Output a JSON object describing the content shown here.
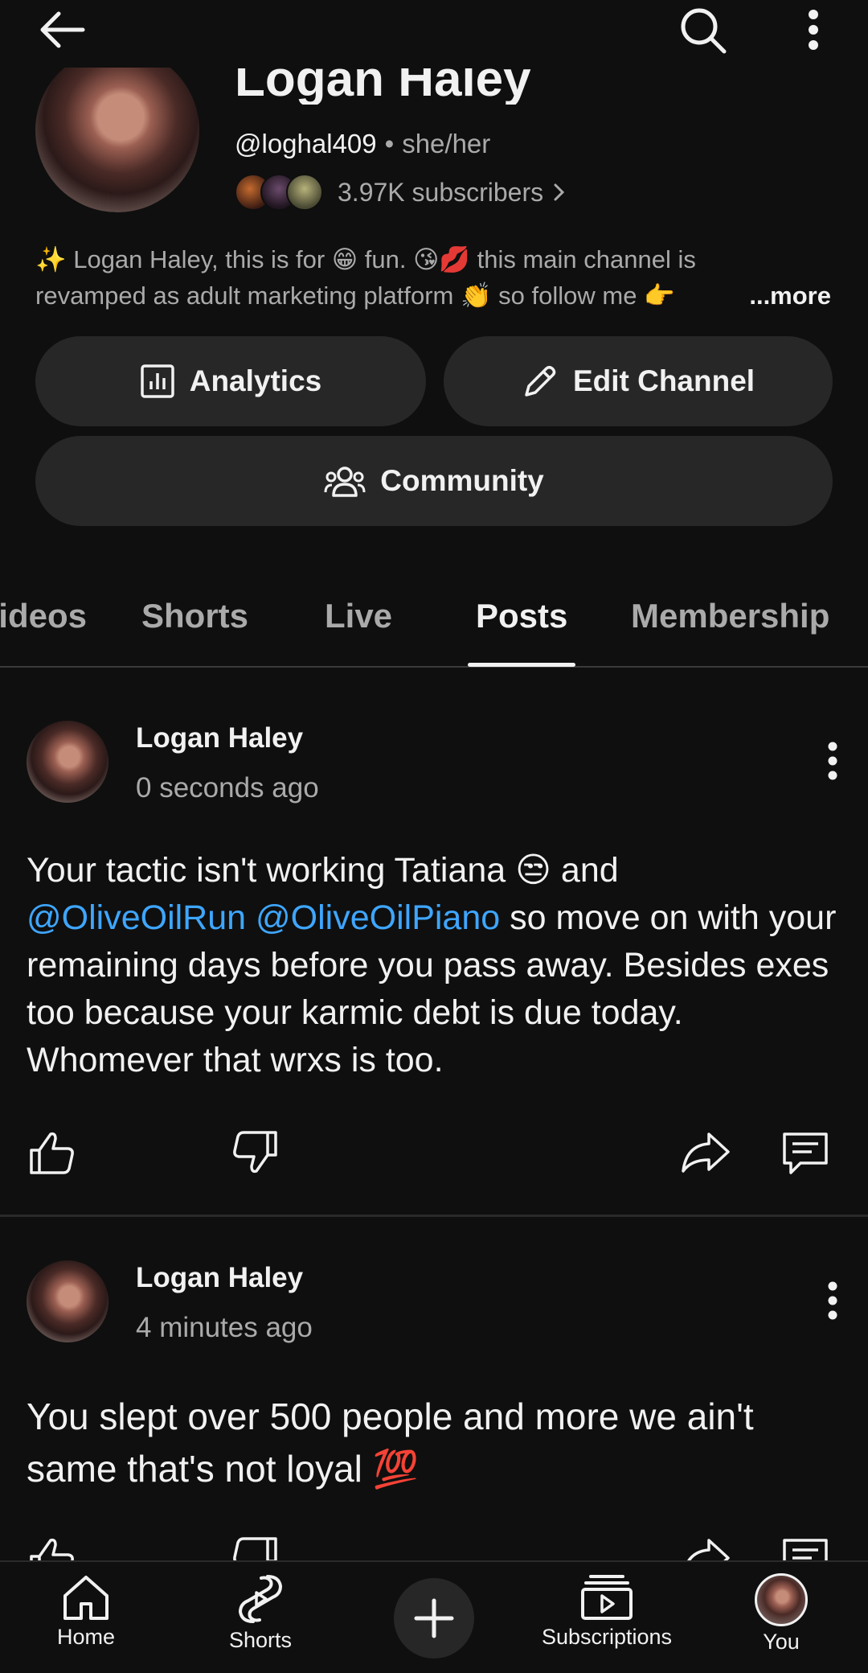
{
  "channel": {
    "name": "Logan Haley",
    "handle": "@loghal409",
    "pronouns": "she/her",
    "separator": "•",
    "subscribers": "3.97K subscribers",
    "bio_line1": "✨ Logan Haley, this is for 😁 fun. 😘💋 this main channel is",
    "bio_line2": "revamped as adult marketing platform 👏 so follow me 👉",
    "bio_more": "...more"
  },
  "actions": {
    "analytics": "Analytics",
    "edit_channel": "Edit Channel",
    "community": "Community"
  },
  "tabs": {
    "videos": "Videos",
    "shorts": "Shorts",
    "live": "Live",
    "posts": "Posts",
    "membership": "Membership",
    "active": "Posts"
  },
  "posts": [
    {
      "author": "Logan Haley",
      "time": "0 seconds ago",
      "text_before": "Your tactic isn't working Tatiana 😒 and",
      "mention1": "@OliveOilRun",
      "mention2": "@OliveOilPiano",
      "text_after": " so move on with your remaining days before you pass away. Besides exes too because your karmic debt is due today.  Whomever that wrxs is too."
    },
    {
      "author": "Logan Haley",
      "time": "4 minutes ago",
      "text": "You slept over 500 people and more we ain't same that's not loyal 💯"
    }
  ],
  "bottom_nav": {
    "home": "Home",
    "shorts": "Shorts",
    "subscriptions": "Subscriptions",
    "you": "You"
  },
  "icons": {
    "back": "arrow-left-icon",
    "search": "search-icon",
    "more": "more-vert-icon",
    "like": "thumb-up-icon",
    "dislike": "thumb-down-icon",
    "share": "share-icon",
    "comment": "comment-icon"
  },
  "colors": {
    "background": "#0f0f0f",
    "pill": "#272727",
    "mention": "#3ea6ff",
    "secondary_text": "#aaaaaa"
  }
}
